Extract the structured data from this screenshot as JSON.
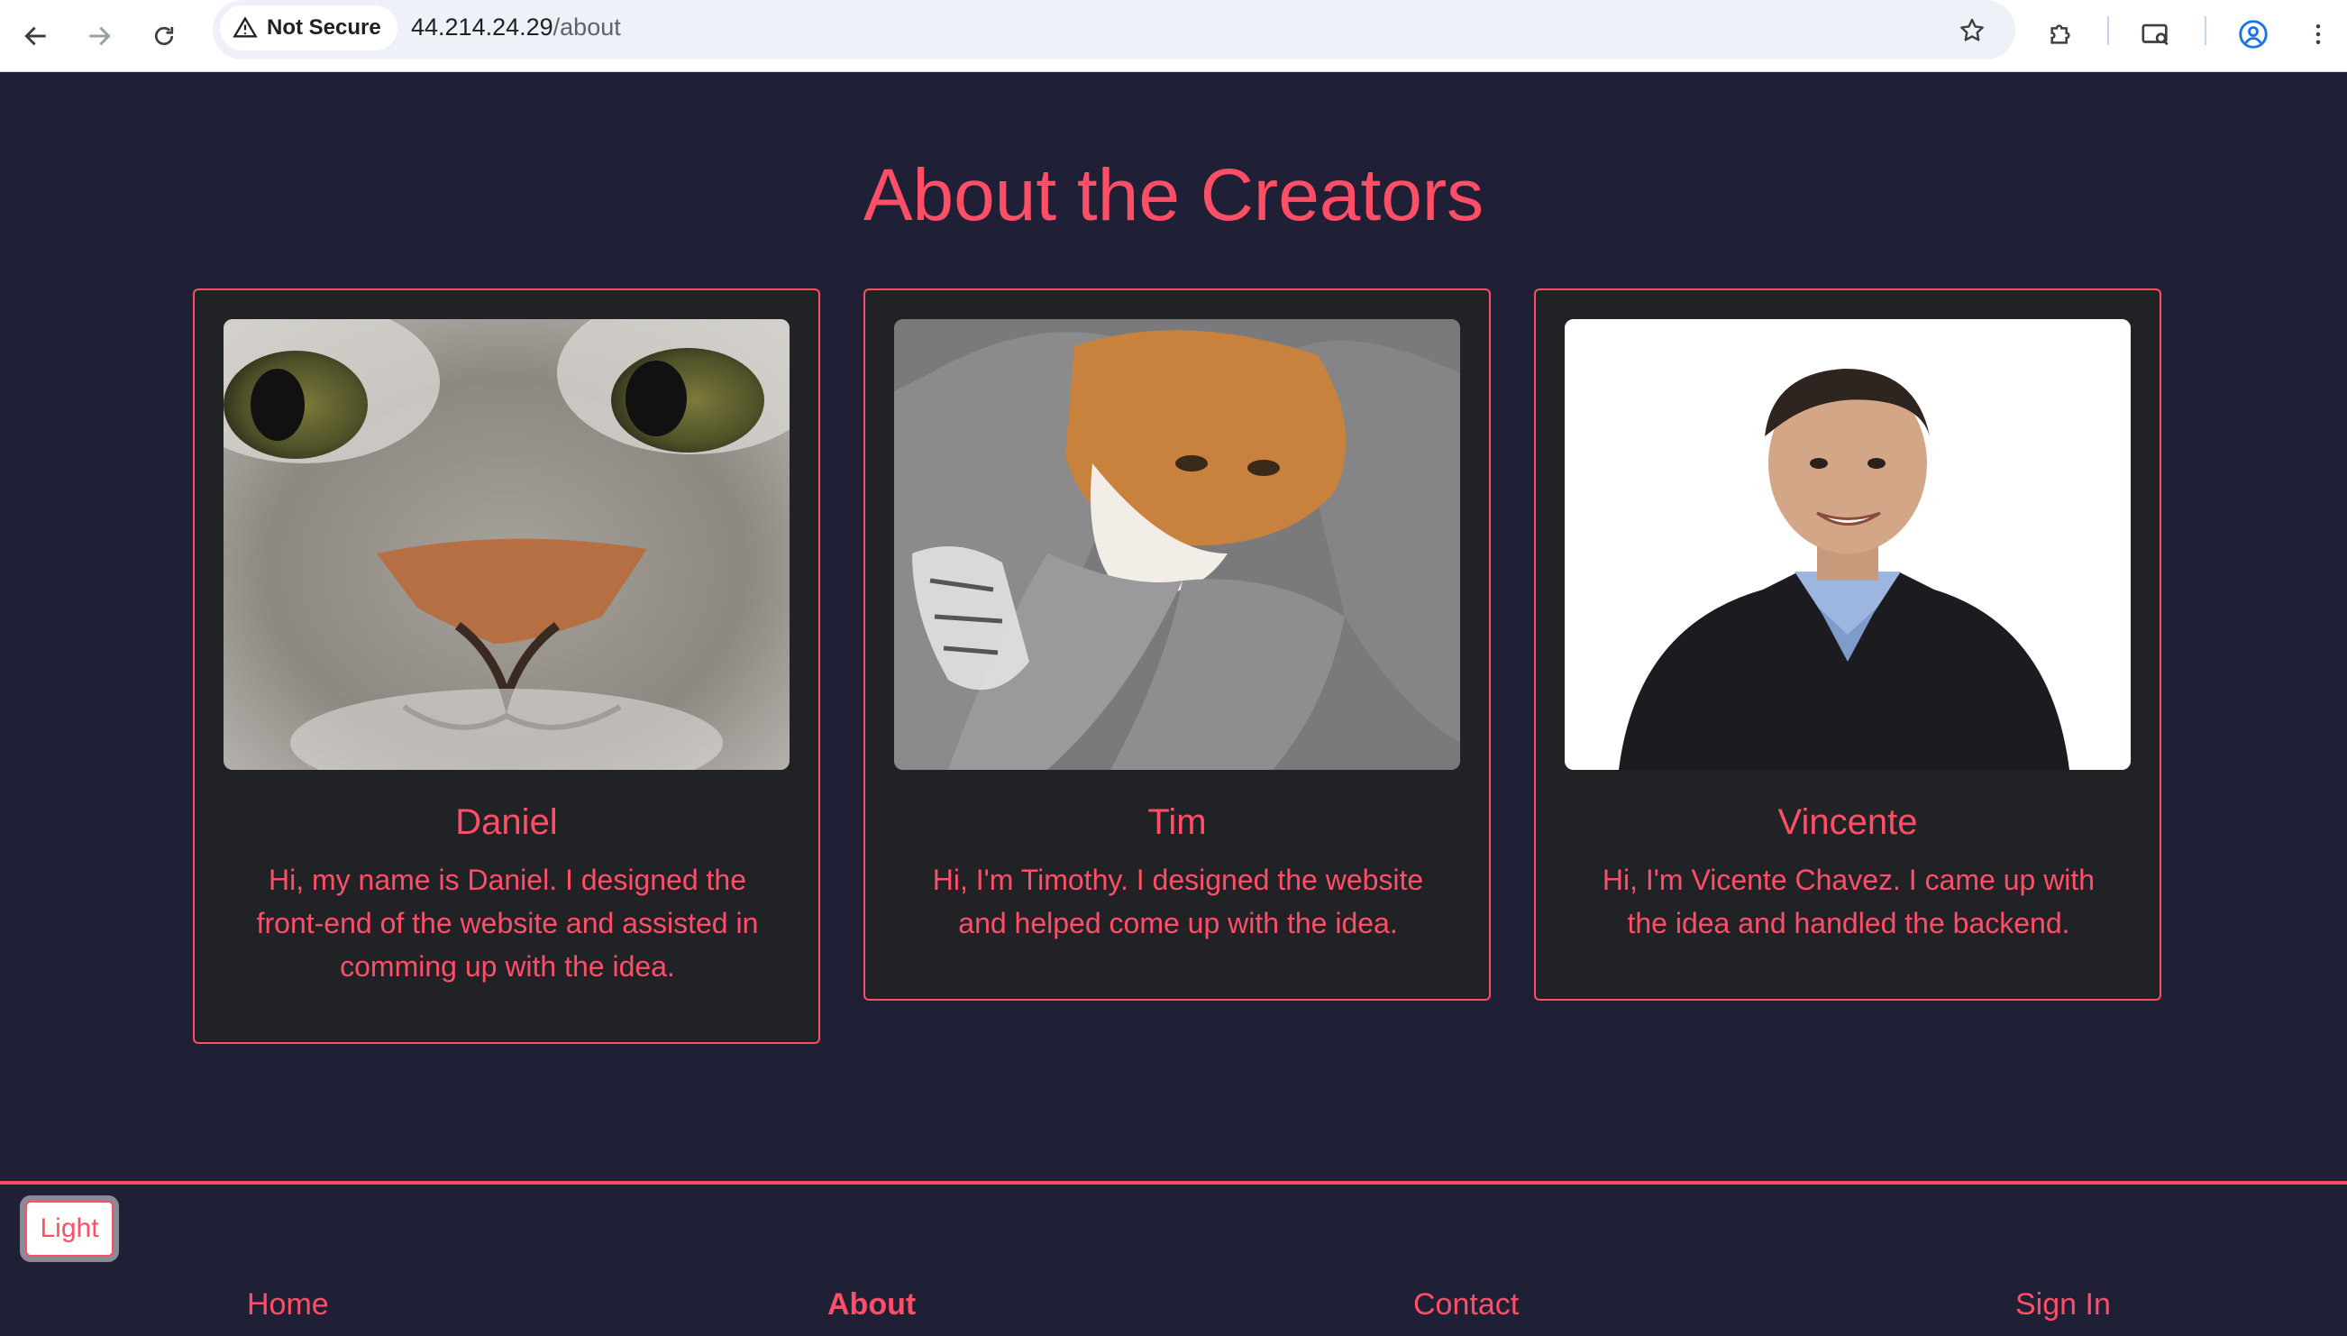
{
  "browser": {
    "security_label": "Not Secure",
    "url_host": "44.214.24.29",
    "url_path": "/about"
  },
  "page": {
    "title": "About the Creators"
  },
  "creators": [
    {
      "name": "Daniel",
      "bio": "Hi, my name is Daniel. I designed the front-end of the website and assisted in comming up with the idea.",
      "photo": "cat-closeup-photo"
    },
    {
      "name": "Tim",
      "bio": "Hi, I'm Timothy. I designed the website and helped come up with the idea.",
      "photo": "cat-in-robe-photo"
    },
    {
      "name": "Vincente",
      "bio": "Hi, I'm Vicente Chavez. I came up with the idea and handled the backend.",
      "photo": "portrait-photo"
    }
  ],
  "theme_toggle": {
    "label": "Light"
  },
  "footer": {
    "links": [
      "Home",
      "About",
      "Contact",
      "Sign In"
    ],
    "active": "About"
  },
  "colors": {
    "accent": "#ff4e66",
    "page_background": "#1f1f36",
    "card_background": "#212226"
  }
}
